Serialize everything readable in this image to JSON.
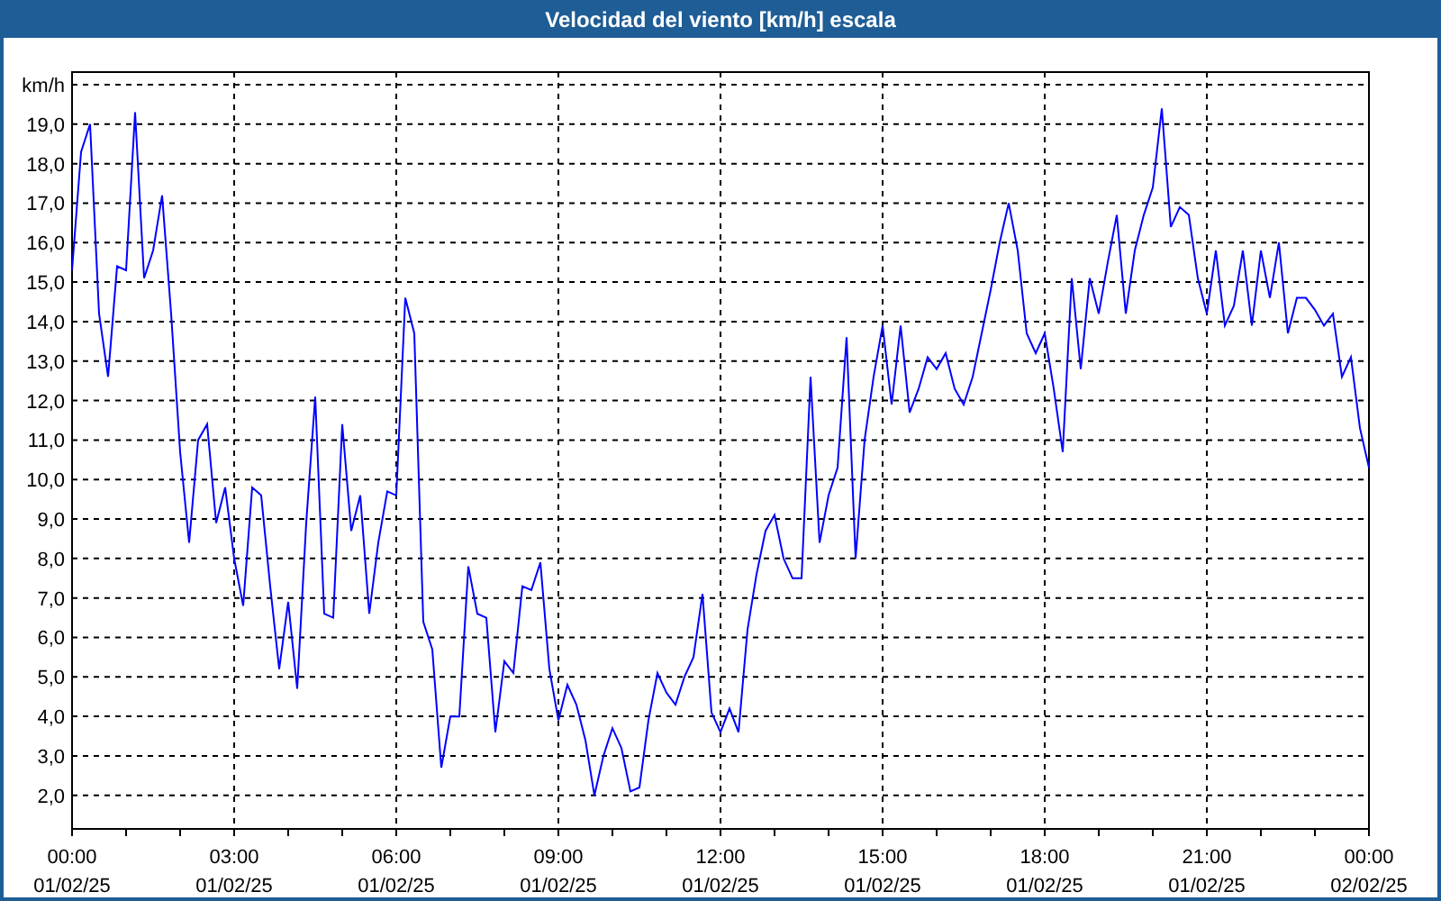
{
  "window": {
    "title": "Velocidad del viento [km/h] escala"
  },
  "chart": {
    "chart_data": {
      "type": "line",
      "grid": true,
      "ylim": [
        1.15,
        20.32
      ],
      "yticks": [
        {
          "value": 2,
          "label": "2,0"
        },
        {
          "value": 3,
          "label": "3,0"
        },
        {
          "value": 4,
          "label": "4,0"
        },
        {
          "value": 5,
          "label": "5,0"
        },
        {
          "value": 6,
          "label": "6,0"
        },
        {
          "value": 7,
          "label": "7,0"
        },
        {
          "value": 8,
          "label": "8,0"
        },
        {
          "value": 9,
          "label": "9,0"
        },
        {
          "value": 10,
          "label": "10,0"
        },
        {
          "value": 11,
          "label": "11,0"
        },
        {
          "value": 12,
          "label": "12,0"
        },
        {
          "value": 13,
          "label": "13,0"
        },
        {
          "value": 14,
          "label": "14,0"
        },
        {
          "value": 15,
          "label": "15,0"
        },
        {
          "value": 16,
          "label": "16,0"
        },
        {
          "value": 17,
          "label": "17,0"
        },
        {
          "value": 18,
          "label": "18,0"
        },
        {
          "value": 19,
          "label": "19,0"
        },
        {
          "value": 20,
          "label": "km/h"
        }
      ],
      "categories": [
        "00:00\n01/02/25",
        null,
        null,
        null,
        null,
        null,
        null,
        null,
        null,
        null,
        null,
        null,
        null,
        null,
        null,
        null,
        null,
        null,
        "03:00\n01/02/25",
        null,
        null,
        null,
        null,
        null,
        null,
        null,
        null,
        null,
        null,
        null,
        null,
        null,
        null,
        null,
        null,
        null,
        "06:00\n01/02/25",
        null,
        null,
        null,
        null,
        null,
        null,
        null,
        null,
        null,
        null,
        null,
        null,
        null,
        null,
        null,
        null,
        null,
        "09:00\n01/02/25",
        null,
        null,
        null,
        null,
        null,
        null,
        null,
        null,
        null,
        null,
        null,
        null,
        null,
        null,
        null,
        null,
        null,
        "12:00\n01/02/25",
        null,
        null,
        null,
        null,
        null,
        null,
        null,
        null,
        null,
        null,
        null,
        null,
        null,
        null,
        null,
        null,
        null,
        "15:00\n01/02/25",
        null,
        null,
        null,
        null,
        null,
        null,
        null,
        null,
        null,
        null,
        null,
        null,
        null,
        null,
        null,
        null,
        null,
        "18:00\n01/02/25",
        null,
        null,
        null,
        null,
        null,
        null,
        null,
        null,
        null,
        null,
        null,
        null,
        null,
        null,
        null,
        null,
        null,
        "21:00\n01/02/25",
        null,
        null,
        null,
        null,
        null,
        null,
        null,
        null,
        null,
        null,
        null,
        null,
        null,
        null,
        null,
        null,
        null,
        "00:00\n02/02/25"
      ],
      "series": [
        {
          "color": "#0000ff",
          "values": [
            15.3,
            18.3,
            19,
            14.2,
            12.6,
            15.4,
            15.3,
            19.3,
            15.1,
            15.8,
            17.2,
            14.2,
            10.7,
            8.4,
            11,
            11.4,
            8.9,
            9.8,
            8,
            6.8,
            9.8,
            9.6,
            7.3,
            5.2,
            6.9,
            4.7,
            8.9,
            12.1,
            6.6,
            6.5,
            11.4,
            8.7,
            9.6,
            6.6,
            8.4,
            9.7,
            9.6,
            14.6,
            13.7,
            6.4,
            5.7,
            2.7,
            4,
            4,
            7.8,
            6.6,
            6.5,
            3.6,
            5.4,
            5.1,
            7.3,
            7.2,
            7.9,
            5.2,
            3.9,
            4.8,
            4.3,
            3.4,
            2,
            3,
            3.7,
            3.2,
            2.1,
            2.2,
            3.9,
            5.1,
            4.6,
            4.3,
            5,
            5.5,
            7.1,
            4.1,
            3.6,
            4.2,
            3.6,
            6.2,
            7.6,
            8.7,
            9.1,
            8,
            7.5,
            7.5,
            12.6,
            8.4,
            9.6,
            10.3,
            13.6,
            8,
            11,
            12.6,
            13.9,
            11.9,
            13.9,
            11.7,
            12.3,
            13.1,
            12.8,
            13.2,
            12.3,
            11.9,
            12.6,
            13.7,
            14.8,
            16,
            17,
            15.8,
            13.7,
            13.2,
            13.7,
            12.3,
            10.7,
            15.1,
            12.8,
            15.1,
            14.2,
            15.5,
            16.7,
            14.2,
            15.8,
            16.7,
            17.4,
            19.4,
            16.4,
            16.9,
            16.7,
            15.1,
            14.2,
            15.8,
            13.9,
            14.4,
            15.8,
            13.9,
            15.8,
            14.6,
            16,
            13.7,
            14.6,
            14.6,
            14.3,
            13.9,
            14.2,
            12.6,
            13.1,
            11.3,
            10.3
          ]
        }
      ]
    }
  }
}
